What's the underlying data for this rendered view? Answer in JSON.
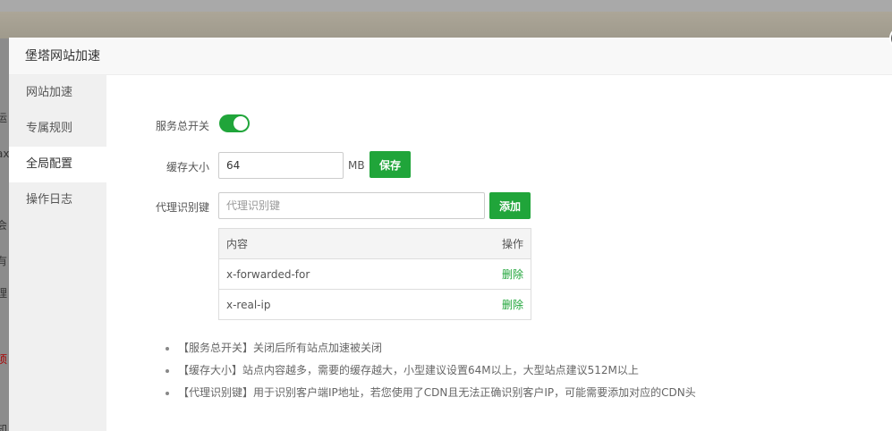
{
  "background": {
    "fragments": [
      {
        "text": "运",
        "red": false
      },
      {
        "text": "ax",
        "red": false
      },
      {
        "text": "会",
        "red": false
      },
      {
        "text": "有",
        "red": false
      },
      {
        "text": "理",
        "red": false
      },
      {
        "text": "项",
        "red": true
      },
      {
        "text": "知",
        "red": false
      }
    ]
  },
  "dialog": {
    "title": "堡塔网站加速"
  },
  "sidebar": {
    "items": [
      {
        "label": "网站加速"
      },
      {
        "label": "专属规则"
      },
      {
        "label": "全局配置"
      },
      {
        "label": "操作日志"
      }
    ],
    "active": 2
  },
  "form": {
    "service_label": "服务总开关",
    "service_on": true,
    "cache_label": "缓存大小",
    "cache_value": "64",
    "cache_unit": "MB",
    "save_label": "保存",
    "proxy_label": "代理识别键",
    "proxy_placeholder": "代理识别键",
    "add_label": "添加"
  },
  "table": {
    "headers": [
      "内容",
      "操作"
    ],
    "rows": [
      {
        "content": "x-forwarded-for",
        "action": "删除"
      },
      {
        "content": "x-real-ip",
        "action": "删除"
      }
    ]
  },
  "notes": [
    "【服务总开关】关闭后所有站点加速被关闭",
    "【缓存大小】站点内容越多，需要的缓存越大，小型建议设置64M以上，大型站点建议512M以上",
    "【代理识别键】用于识别客户端IP地址，若您使用了CDN且无法正确识别客户IP，可能需要添加对应的CDN头"
  ],
  "colors": {
    "accent": "#20a53a"
  }
}
